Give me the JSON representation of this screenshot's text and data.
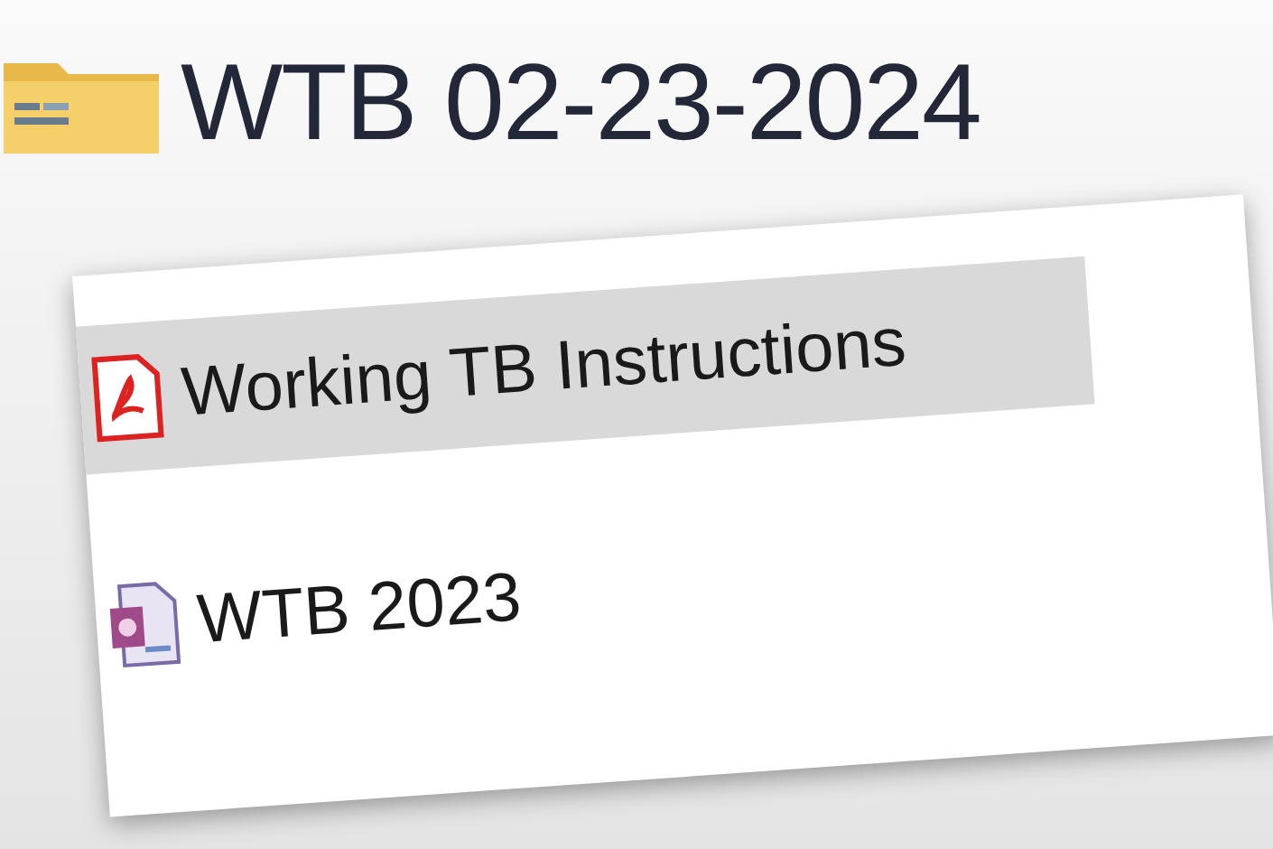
{
  "folder": {
    "title": "WTB 02-23-2024"
  },
  "files": [
    {
      "name": "Working TB Instructions",
      "kind": "pdf",
      "selected": true
    },
    {
      "name": "WTB 2023",
      "kind": "database",
      "selected": false
    }
  ]
}
